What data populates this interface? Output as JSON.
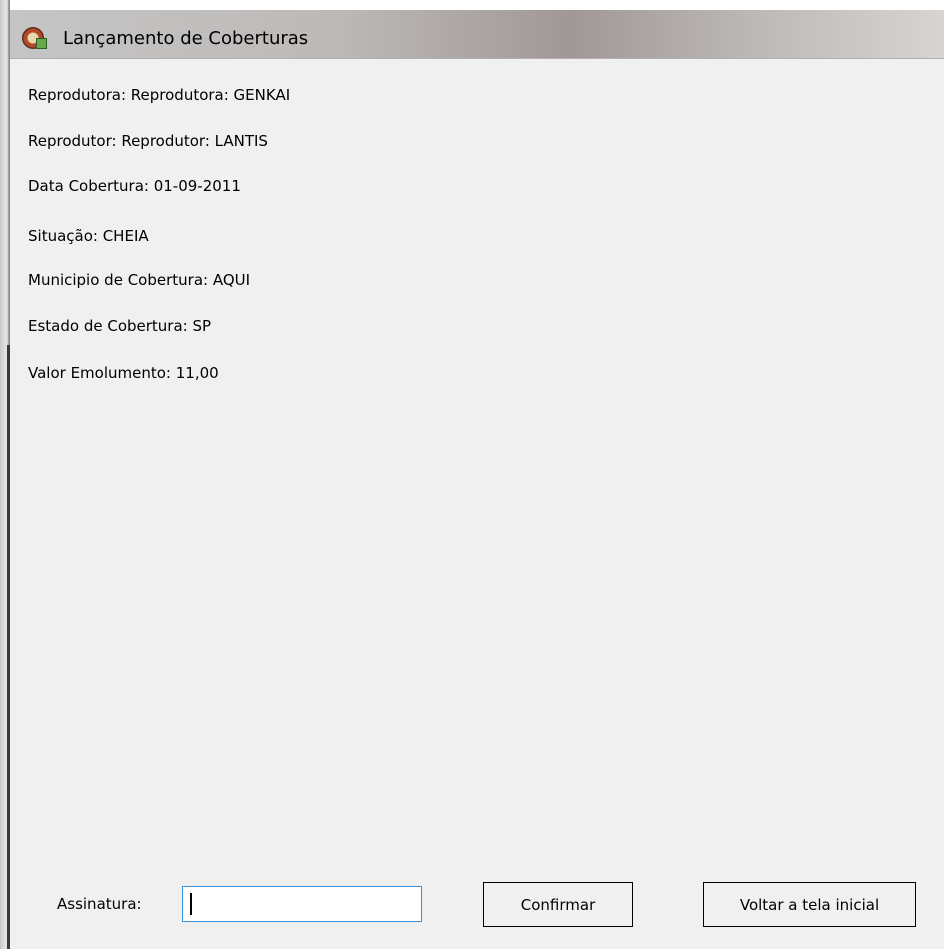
{
  "window": {
    "title": "Lançamento de Coberturas"
  },
  "details": {
    "reprodutora": "Reprodutora: Reprodutora: GENKAI",
    "reprodutor": "Reprodutor: Reprodutor: LANTIS",
    "data_cobertura": "Data Cobertura: 01-09-2011",
    "situacao": "Situação: CHEIA",
    "municipio": "Municipio de Cobertura: AQUI",
    "estado": "Estado de Cobertura: SP",
    "valor": "Valor Emolumento: 11,00"
  },
  "form": {
    "signature_label": "Assinatura:",
    "signature_value": "",
    "confirm_label": "Confirmar",
    "back_label": "Voltar a tela inicial"
  },
  "colors": {
    "background": "#f0f0f0",
    "input_focus_border": "#3b8fd9"
  }
}
